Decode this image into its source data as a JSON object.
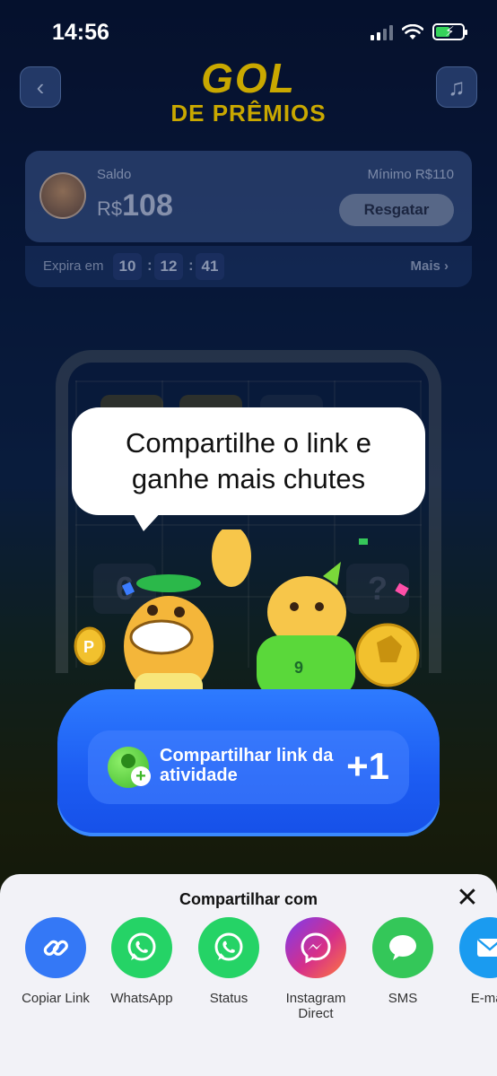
{
  "status_bar": {
    "time": "14:56"
  },
  "header": {
    "logo_line1": "GOL",
    "logo_line2": "DE PRÊMIOS"
  },
  "balance": {
    "saldo_label": "Saldo",
    "currency": "R$",
    "amount": "108",
    "minimo_label": "Mínimo  R$110",
    "resgatar_label": "Resgatar",
    "expira_label": "Expira em",
    "timer": [
      "10",
      "12",
      "41"
    ],
    "mais_label": "Mais ›"
  },
  "bubble": {
    "text": "Compartilhe o link e ganhe mais chutes"
  },
  "share_activity": {
    "label": "Compartilhar link da atividade",
    "bonus": "+1"
  },
  "share_sheet": {
    "title": "Compartilhar com",
    "apps": [
      {
        "label": "Copiar Link",
        "icon": "link-icon",
        "color": "#3478f6"
      },
      {
        "label": "WhatsApp",
        "icon": "whatsapp-icon",
        "color": "#25d366"
      },
      {
        "label": "Status",
        "icon": "whatsapp-status-icon",
        "color": "#25d366"
      },
      {
        "label": "Instagram Direct",
        "icon": "messenger-icon",
        "color": "#c13584"
      },
      {
        "label": "SMS",
        "icon": "sms-icon",
        "color": "#34c759"
      },
      {
        "label": "E-mail",
        "icon": "email-icon",
        "color": "#1a9bf0"
      }
    ]
  }
}
